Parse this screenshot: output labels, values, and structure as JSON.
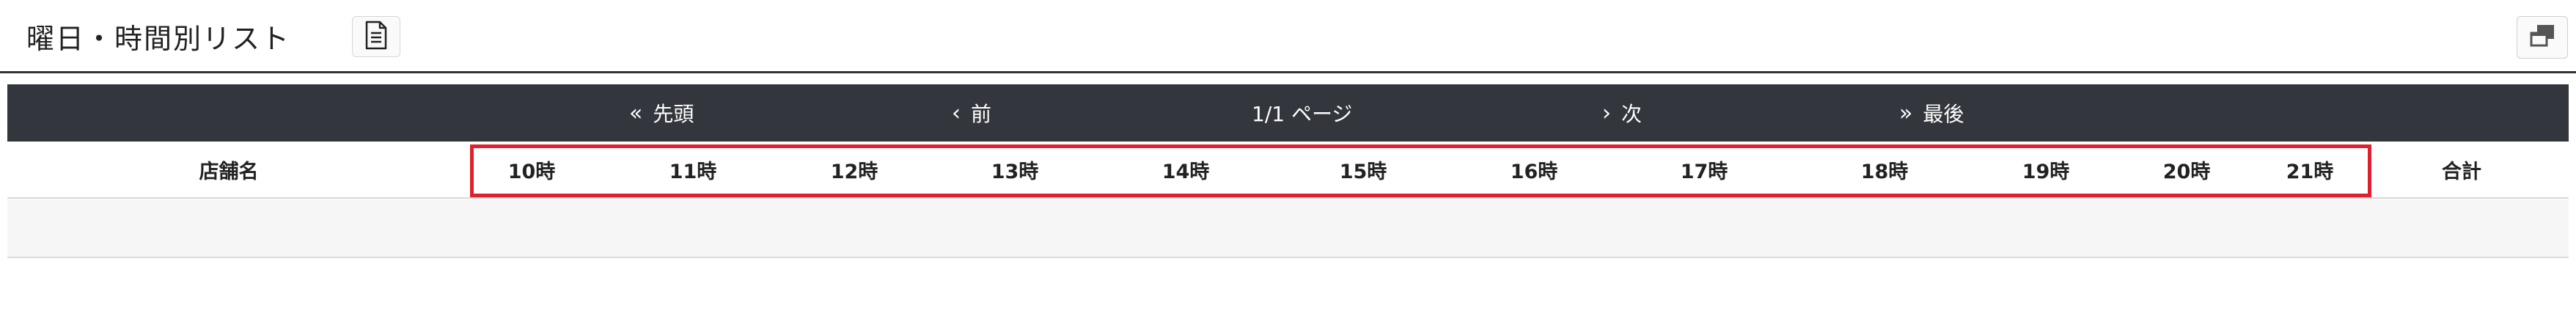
{
  "header": {
    "title": "曜日・時間別リスト",
    "doc_icon": "document-icon",
    "popout_icon": "window-restore-icon"
  },
  "pager": {
    "first": "先頭",
    "prev": "前",
    "page_info": "1/1 ページ",
    "next": "次",
    "last": "最後"
  },
  "table": {
    "store_header": "店舗名",
    "hours": [
      "10時",
      "11時",
      "12時",
      "13時",
      "14時",
      "15時",
      "16時",
      "17時",
      "18時",
      "19時",
      "20時",
      "21時"
    ],
    "total_header": "合計",
    "rows": []
  },
  "colors": {
    "pager_bg": "#34363d",
    "highlight": "#e0202e",
    "row_bg": "#f6f6f6"
  }
}
